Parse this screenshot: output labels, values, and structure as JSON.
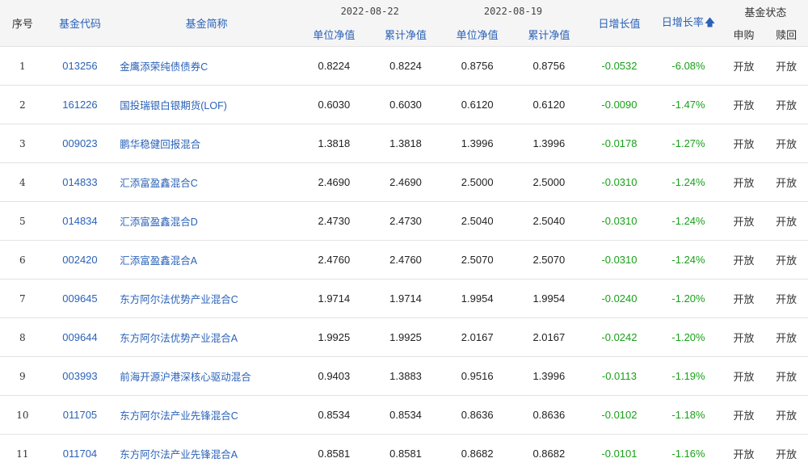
{
  "header": {
    "idx": "序号",
    "code": "基金代码",
    "name": "基金简称",
    "date1": "2022-08-22",
    "date2": "2022-08-19",
    "unit_nav": "单位净值",
    "acc_nav": "累计净值",
    "day_growth": "日增长值",
    "day_rate": "日增长率",
    "sort_icon": "arrow-up-icon",
    "status_group": "基金状态",
    "subscribe": "申购",
    "redeem": "赎回"
  },
  "rows": [
    {
      "idx": "1",
      "code": "013256",
      "name": "金鹰添荣纯债债券C",
      "nav1": "0.8224",
      "acc1": "0.8224",
      "nav2": "0.8756",
      "acc2": "0.8756",
      "growth": "-0.0532",
      "rate": "-6.08%",
      "subscribe": "开放",
      "redeem": "开放"
    },
    {
      "idx": "2",
      "code": "161226",
      "name": "国投瑞银白银期货(LOF)",
      "nav1": "0.6030",
      "acc1": "0.6030",
      "nav2": "0.6120",
      "acc2": "0.6120",
      "growth": "-0.0090",
      "rate": "-1.47%",
      "subscribe": "开放",
      "redeem": "开放"
    },
    {
      "idx": "3",
      "code": "009023",
      "name": "鹏华稳健回报混合",
      "nav1": "1.3818",
      "acc1": "1.3818",
      "nav2": "1.3996",
      "acc2": "1.3996",
      "growth": "-0.0178",
      "rate": "-1.27%",
      "subscribe": "开放",
      "redeem": "开放"
    },
    {
      "idx": "4",
      "code": "014833",
      "name": "汇添富盈鑫混合C",
      "nav1": "2.4690",
      "acc1": "2.4690",
      "nav2": "2.5000",
      "acc2": "2.5000",
      "growth": "-0.0310",
      "rate": "-1.24%",
      "subscribe": "开放",
      "redeem": "开放"
    },
    {
      "idx": "5",
      "code": "014834",
      "name": "汇添富盈鑫混合D",
      "nav1": "2.4730",
      "acc1": "2.4730",
      "nav2": "2.5040",
      "acc2": "2.5040",
      "growth": "-0.0310",
      "rate": "-1.24%",
      "subscribe": "开放",
      "redeem": "开放"
    },
    {
      "idx": "6",
      "code": "002420",
      "name": "汇添富盈鑫混合A",
      "nav1": "2.4760",
      "acc1": "2.4760",
      "nav2": "2.5070",
      "acc2": "2.5070",
      "growth": "-0.0310",
      "rate": "-1.24%",
      "subscribe": "开放",
      "redeem": "开放"
    },
    {
      "idx": "7",
      "code": "009645",
      "name": "东方阿尔法优势产业混合C",
      "nav1": "1.9714",
      "acc1": "1.9714",
      "nav2": "1.9954",
      "acc2": "1.9954",
      "growth": "-0.0240",
      "rate": "-1.20%",
      "subscribe": "开放",
      "redeem": "开放"
    },
    {
      "idx": "8",
      "code": "009644",
      "name": "东方阿尔法优势产业混合A",
      "nav1": "1.9925",
      "acc1": "1.9925",
      "nav2": "2.0167",
      "acc2": "2.0167",
      "growth": "-0.0242",
      "rate": "-1.20%",
      "subscribe": "开放",
      "redeem": "开放"
    },
    {
      "idx": "9",
      "code": "003993",
      "name": "前海开源沪港深核心驱动混合",
      "nav1": "0.9403",
      "acc1": "1.3883",
      "nav2": "0.9516",
      "acc2": "1.3996",
      "growth": "-0.0113",
      "rate": "-1.19%",
      "subscribe": "开放",
      "redeem": "开放"
    },
    {
      "idx": "10",
      "code": "011705",
      "name": "东方阿尔法产业先锋混合C",
      "nav1": "0.8534",
      "acc1": "0.8534",
      "nav2": "0.8636",
      "acc2": "0.8636",
      "growth": "-0.0102",
      "rate": "-1.18%",
      "subscribe": "开放",
      "redeem": "开放"
    },
    {
      "idx": "11",
      "code": "011704",
      "name": "东方阿尔法产业先锋混合A",
      "nav1": "0.8581",
      "acc1": "0.8581",
      "nav2": "0.8682",
      "acc2": "0.8682",
      "growth": "-0.0101",
      "rate": "-1.16%",
      "subscribe": "开放",
      "redeem": "开放"
    }
  ],
  "colors": {
    "link": "#2b62b8",
    "negative": "#19a019",
    "header_bg": "#f5f5f5"
  }
}
